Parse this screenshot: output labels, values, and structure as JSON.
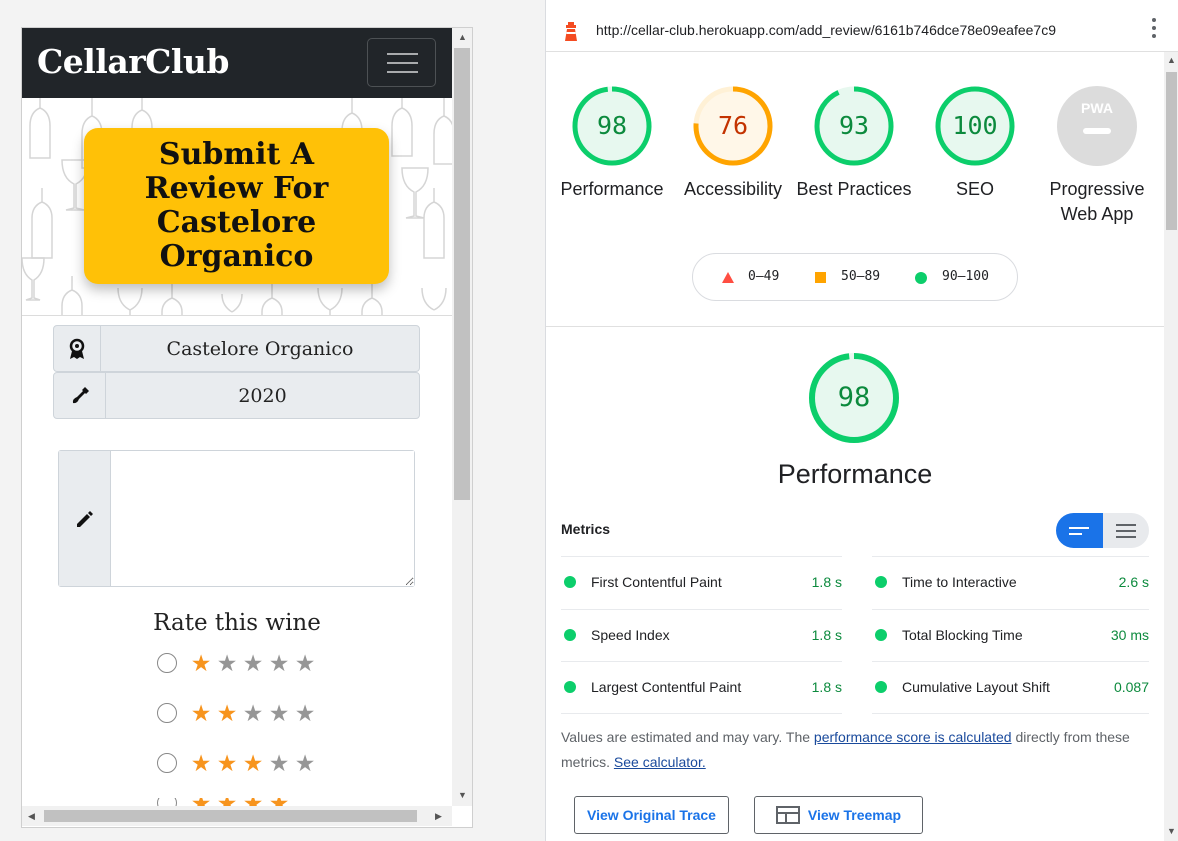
{
  "left": {
    "brand": "CellarClub",
    "hero_title": "Submit A Review For Castelore Organico",
    "wine_name": "Castelore Organico",
    "vintage": "2020",
    "review_placeholder": "",
    "rate_label": "Rate this wine",
    "ratings": [
      {
        "value": 1,
        "label": "1 star"
      },
      {
        "value": 2,
        "label": "2 stars"
      },
      {
        "value": 3,
        "label": "3 stars"
      }
    ],
    "colors": {
      "navbar": "#212529",
      "hero_card": "#ffc107",
      "star_on": "#f7941d",
      "star_off": "#969696"
    }
  },
  "lighthouse": {
    "url": "http://cellar-club.herokuapp.com/add_review/6161b746dce78e09eafee7c9",
    "gauges": [
      {
        "label": "Performance",
        "score": 98,
        "status": "pass"
      },
      {
        "label": "Accessibility",
        "score": 76,
        "status": "average"
      },
      {
        "label": "Best Practices",
        "score": 93,
        "status": "pass"
      },
      {
        "label": "SEO",
        "score": 100,
        "status": "pass"
      },
      {
        "label": "Progressive Web App",
        "score": "PWA",
        "status": "na"
      }
    ],
    "legend": [
      {
        "range": "0–49",
        "shape": "triangle",
        "color": "#ff4e42"
      },
      {
        "range": "50–89",
        "shape": "square",
        "color": "#ffa400"
      },
      {
        "range": "90–100",
        "shape": "circle",
        "color": "#0cce6b"
      }
    ],
    "category": {
      "title": "Performance",
      "score": 98
    },
    "metrics_title": "Metrics",
    "metrics": [
      {
        "name": "First Contentful Paint",
        "value": "1.8 s"
      },
      {
        "name": "Time to Interactive",
        "value": "2.6 s"
      },
      {
        "name": "Speed Index",
        "value": "1.8 s"
      },
      {
        "name": "Total Blocking Time",
        "value": "30 ms"
      },
      {
        "name": "Largest Contentful Paint",
        "value": "1.8 s"
      },
      {
        "name": "Cumulative Layout Shift",
        "value": "0.087"
      }
    ],
    "note": {
      "prefix": "Values are estimated and may vary. The ",
      "link1": "performance score is calculated",
      "middle": " directly from these metrics. ",
      "link2": "See calculator."
    },
    "buttons": {
      "trace": "View Original Trace",
      "treemap": "View Treemap"
    },
    "colors": {
      "pass": "#0cce6b",
      "average": "#ffa400",
      "fail": "#ff4e42",
      "accent": "#1a73e8"
    }
  }
}
